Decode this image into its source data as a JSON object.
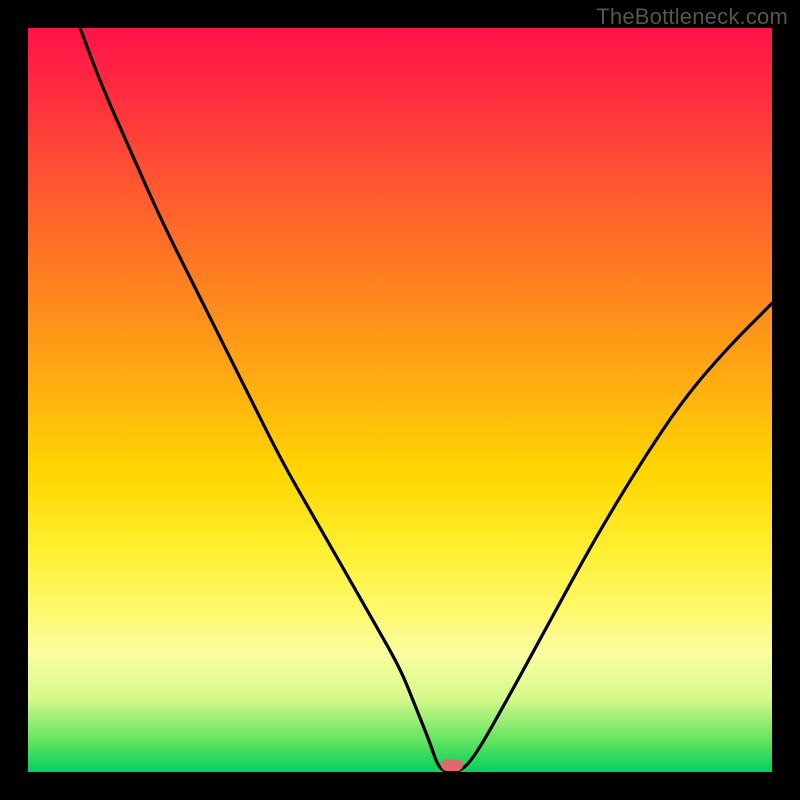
{
  "watermark": "TheBottleneck.com",
  "colors": {
    "frame_bg": "#000000",
    "curve_stroke": "#000000",
    "marker_fill": "#e06a6a",
    "gradient_stops": [
      "#ff1448",
      "#ff2a40",
      "#ff5a2f",
      "#ff8020",
      "#ffae10",
      "#ffd700",
      "#ffef30",
      "#fff96a",
      "#fbfda0",
      "#d8f98a",
      "#5ee25e",
      "#00d060"
    ]
  },
  "chart_data": {
    "type": "line",
    "title": "",
    "xlabel": "",
    "ylabel": "",
    "xlim": [
      0,
      100
    ],
    "ylim": [
      0,
      100
    ],
    "series": [
      {
        "name": "bottleneck-curve",
        "x": [
          7,
          10,
          14,
          18,
          22,
          26,
          30,
          34,
          38,
          42,
          46,
          50,
          52,
          54,
          55,
          56,
          58,
          60,
          64,
          70,
          76,
          82,
          88,
          94,
          100
        ],
        "y": [
          100,
          92,
          83,
          74,
          66,
          58,
          50,
          42,
          35,
          28,
          21,
          14,
          9,
          4,
          1,
          0,
          0,
          2,
          9,
          20,
          31,
          41,
          50,
          57,
          63
        ]
      }
    ],
    "flat_segment": {
      "x_start": 54,
      "x_end": 59,
      "y": 0
    },
    "marker": {
      "x": 57,
      "y": 1
    }
  }
}
